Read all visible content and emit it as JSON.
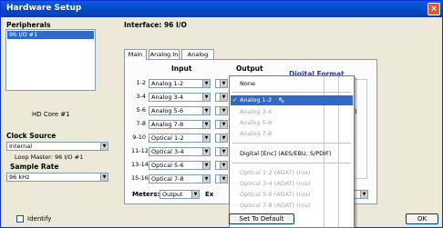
{
  "window": {
    "title": "Hardware Setup",
    "close": "×"
  },
  "peripherals": {
    "title": "Peripherals",
    "items": [
      "96 I/O #1"
    ],
    "selected": 0
  },
  "interface": {
    "label": "Interface:  96 I/O"
  },
  "tabs": [
    "Main",
    "Analog In",
    "Analog Out"
  ],
  "grid": {
    "input_header": "Input",
    "output_header": "Output",
    "digital_format_header": "Digital Format",
    "rows": [
      {
        "ch": "1-2",
        "input": "Analog 1-2"
      },
      {
        "ch": "3-4",
        "input": "Analog 3-4"
      },
      {
        "ch": "5-6",
        "input": "Analog 5-6"
      },
      {
        "ch": "7-8",
        "input": "Analog 7-8"
      },
      {
        "ch": "9-10",
        "input": "Optical 1-2"
      },
      {
        "ch": "11-12",
        "input": "Optical 3-4"
      },
      {
        "ch": "13-14",
        "input": "Optical 5-6"
      },
      {
        "ch": "15-16",
        "input": "Optical 7-8"
      }
    ],
    "meters_label": "Meters:",
    "meters_value": "Output",
    "ext_label": "Ex"
  },
  "core": {
    "label": "HD Core #1"
  },
  "clock": {
    "title": "Clock Source",
    "value": "Internal",
    "loop_master": "Loop Master: 96 I/O #1"
  },
  "sample_rate": {
    "title": "Sample Rate",
    "value": "96 kHz"
  },
  "dropdown": {
    "items": [
      {
        "label": "None",
        "state": "normal"
      },
      {
        "label": "Analog 1-2",
        "state": "highlighted",
        "check": "✓"
      },
      {
        "label": "Analog 3-4",
        "state": "disabled"
      },
      {
        "label": "Analog 5-6",
        "state": "disabled"
      },
      {
        "label": "Analog 7-8",
        "state": "disabled"
      },
      {
        "label": "Digital [Enc] (AES/EBU, S/PDIF)",
        "state": "normal"
      },
      {
        "label": "Optical 1-2 (ADAT) (n/a)",
        "state": "disabled"
      },
      {
        "label": "Optical 3-4 (ADAT) (n/a)",
        "state": "disabled"
      },
      {
        "label": "Optical 5-6 (ADAT) (n/a)",
        "state": "disabled"
      },
      {
        "label": "Optical 7-8 (ADAT) (n/a)",
        "state": "disabled"
      }
    ]
  },
  "footer": {
    "identify": "Identify",
    "set_default": "Set To Default",
    "ok": "OK"
  }
}
